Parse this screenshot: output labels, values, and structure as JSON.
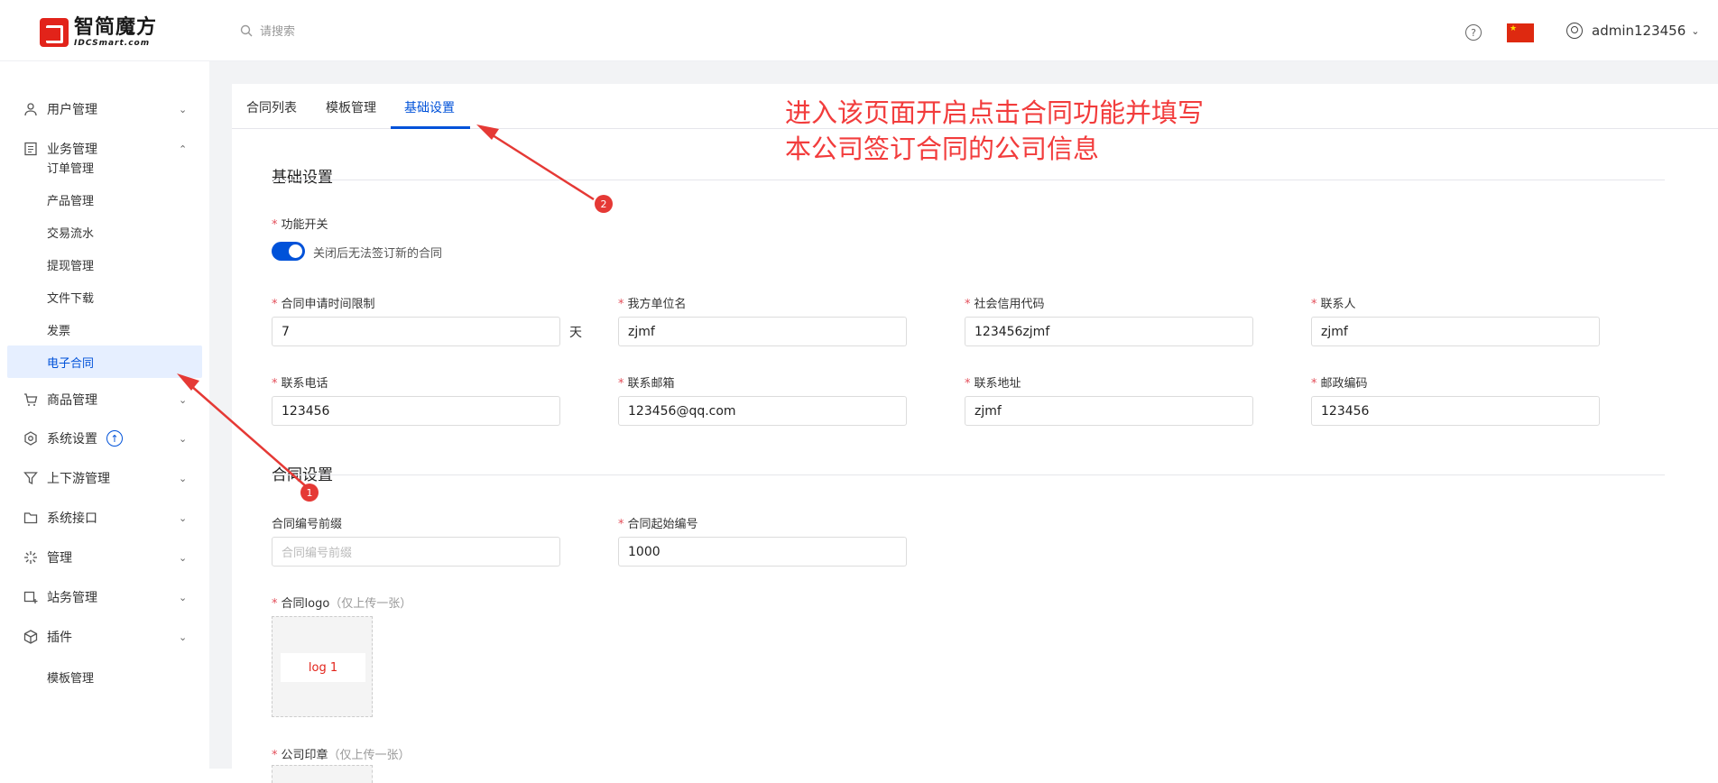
{
  "header": {
    "logo_cn": "智简魔方",
    "logo_en": "IDCSmart.com",
    "search_placeholder": "请搜索",
    "help_symbol": "?",
    "username": "admin123456",
    "flag_icon": "china-flag-icon"
  },
  "sidebar": {
    "menu": [
      {
        "label": "用户管理",
        "icon": "user-icon"
      },
      {
        "label": "业务管理",
        "icon": "document-icon"
      },
      {
        "label": "商品管理",
        "icon": "cart-icon"
      },
      {
        "label": "系统设置",
        "icon": "settings-icon"
      },
      {
        "label": "上下游管理",
        "icon": "filter-icon"
      },
      {
        "label": "系统接口",
        "icon": "folder-icon"
      },
      {
        "label": "管理",
        "icon": "sparkle-icon"
      },
      {
        "label": "站务管理",
        "icon": "site-icon"
      },
      {
        "label": "插件",
        "icon": "box-icon"
      }
    ],
    "business_sub": [
      "订单管理",
      "产品管理",
      "交易流水",
      "提现管理",
      "文件下载",
      "发票",
      "电子合同"
    ],
    "plugin_sub": [
      "模板管理"
    ],
    "system_badge": "↑"
  },
  "tabs": [
    "合同列表",
    "模板管理",
    "基础设置"
  ],
  "basic": {
    "section_title": "基础设置",
    "switch_label": "功能开关",
    "switch_text": "关闭后无法签订新的合同",
    "switch_on": true,
    "fields": [
      {
        "label": "合同申请时间限制",
        "value": "7",
        "unit": "天"
      },
      {
        "label": "我方单位名",
        "value": "zjmf"
      },
      {
        "label": "社会信用代码",
        "value": "123456zjmf"
      },
      {
        "label": "联系人",
        "value": "zjmf"
      },
      {
        "label": "联系电话",
        "value": "123456"
      },
      {
        "label": "联系邮箱",
        "value": "123456@qq.com"
      },
      {
        "label": "联系地址",
        "value": "zjmf"
      },
      {
        "label": "邮政编码",
        "value": "123456"
      }
    ]
  },
  "contract": {
    "section_title": "合同设置",
    "prefix_label": "合同编号前缀",
    "prefix_placeholder": "合同编号前缀",
    "start_label": "合同起始编号",
    "start_value": "1000",
    "logo_label": "合同logo",
    "logo_hint": "（仅上传一张）",
    "logo_preview": "log 1",
    "seal_label": "公司印章",
    "seal_hint": "（仅上传一张）"
  },
  "annotation": {
    "line1": "进入该页面开启点击合同功能并填写",
    "line2": "本公司签订合同的公司信息",
    "marker1": "1",
    "marker2": "2",
    "color": "#f23c3c"
  },
  "colors": {
    "accent": "#0052d9",
    "required": "#e34d59"
  }
}
